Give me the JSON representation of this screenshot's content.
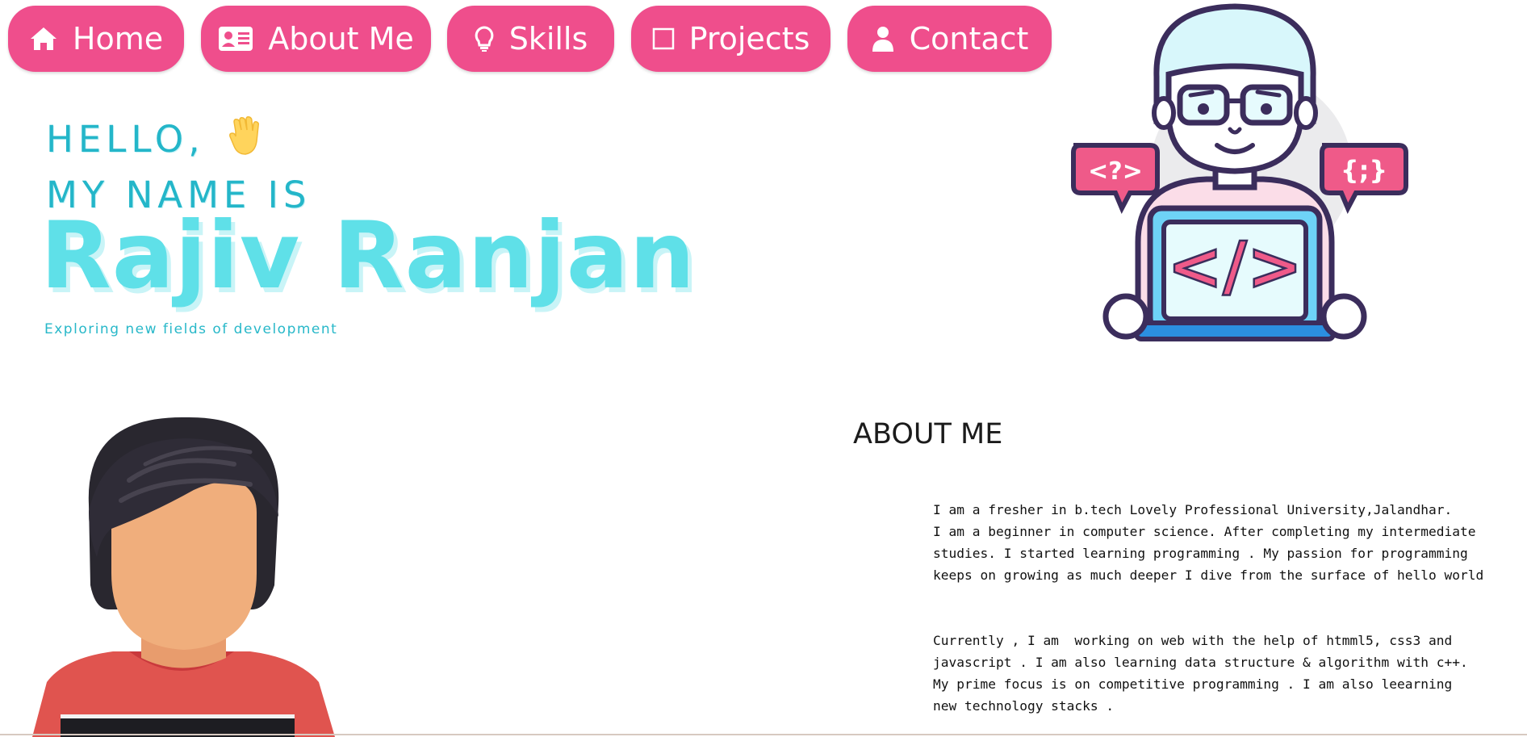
{
  "nav": {
    "items": [
      {
        "label": "Home",
        "icon": "home-icon"
      },
      {
        "label": "About Me",
        "icon": "id-card-icon"
      },
      {
        "label": "Skills",
        "icon": "lightbulb-icon"
      },
      {
        "label": "Projects",
        "icon": "square-icon"
      },
      {
        "label": "Contact",
        "icon": "user-icon"
      }
    ],
    "color": "#ef4e8c"
  },
  "hero": {
    "greeting": "HELLO,",
    "greeting_icon": "waving-hand-icon",
    "intro": "MY NAME IS",
    "name": "Rajiv Ranjan",
    "tagline": "Exploring new fields of development",
    "accent_color": "#5fe0e8"
  },
  "illustrations": {
    "top": {
      "icon": "coder-laptop-illustration",
      "bubble_left": "<?>",
      "bubble_right": "{;}",
      "screen_text": "</>"
    },
    "bottom": {
      "icon": "developer-avatar-illustration"
    }
  },
  "about": {
    "title": "ABOUT ME",
    "paragraph1": "I am a fresher in b.tech Lovely Professional University,Jalandhar.\nI am a beginner in computer science. After completing my intermediate\nstudies. I started learning programming . My passion for programming\nkeeps on growing as much deeper I dive from the surface of hello world",
    "paragraph2": "Currently , I am  working on web with the help of htmml5, css3 and\njavascript . I am also learning data structure & algorithm with c++.\nMy prime focus is on competitive programming . I am also leearning\nnew technology stacks ."
  }
}
